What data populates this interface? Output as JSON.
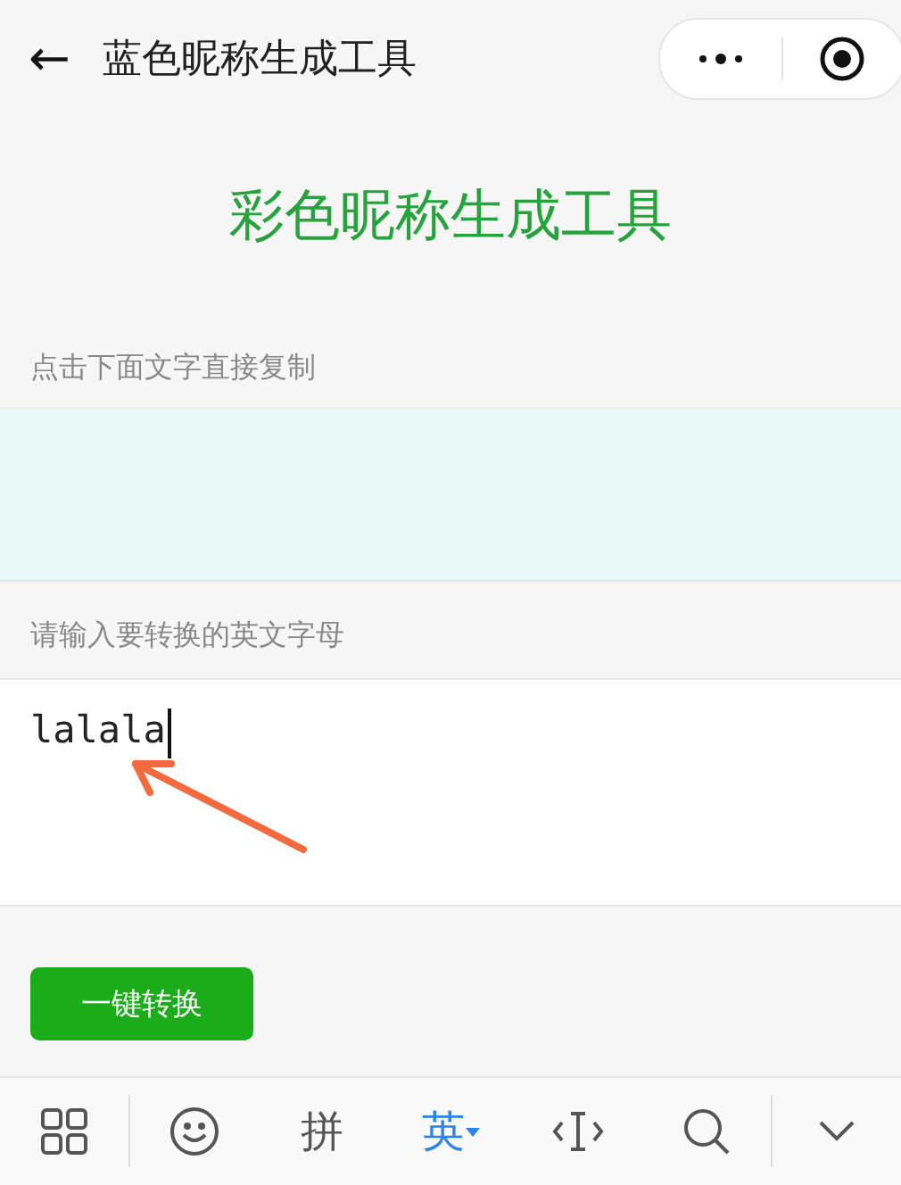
{
  "nav": {
    "back": "←",
    "title": "蓝色昵称生成工具"
  },
  "heading": "彩色昵称生成工具",
  "output": {
    "label": "点击下面文字直接复制"
  },
  "input": {
    "label": "请输入要转换的英文字母",
    "value": "lalala",
    "focused": true
  },
  "convert_button": "一键转换",
  "keyboard": {
    "keys": [
      {
        "kind": "grid",
        "selected": false
      },
      {
        "kind": "smiley",
        "selected": false
      },
      {
        "kind": "text",
        "label": "拼",
        "selected": false
      },
      {
        "kind": "text",
        "label": "英",
        "selected": true
      },
      {
        "kind": "cursor",
        "selected": false
      },
      {
        "kind": "search",
        "selected": false
      },
      {
        "kind": "collapse",
        "selected": false
      }
    ]
  }
}
